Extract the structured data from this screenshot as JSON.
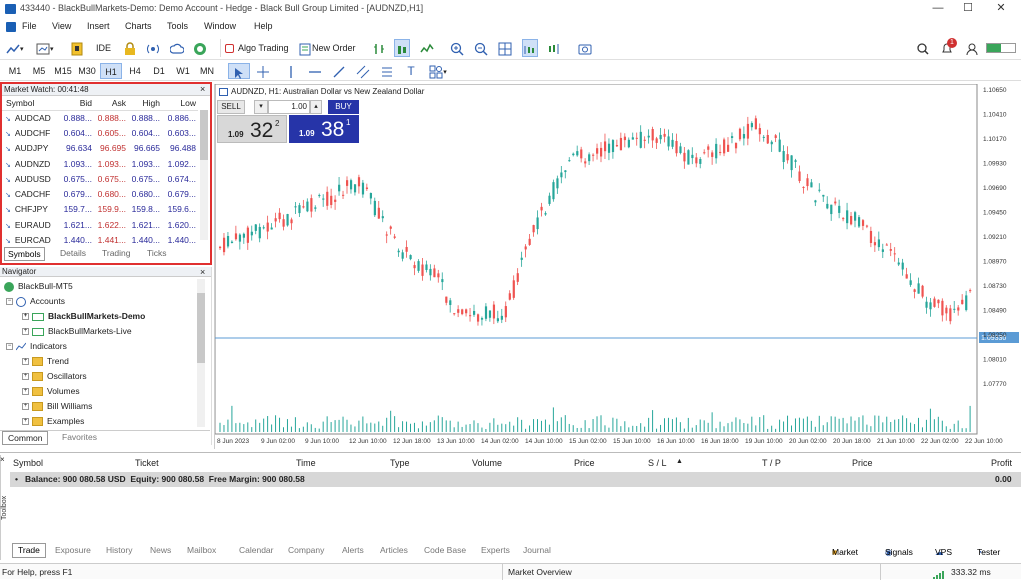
{
  "window": {
    "title": "433440 - BlackBullMarkets-Demo: Demo Account - Hedge - Black Bull Group Limited - [AUDNZD,H1]",
    "minimize": "—",
    "maximize": "☐",
    "close": "✕"
  },
  "menu": [
    "File",
    "View",
    "Insert",
    "Charts",
    "Tools",
    "Window",
    "Help"
  ],
  "toolbar": {
    "ide": "IDE",
    "algo_trading": "Algo Trading",
    "new_order": "New Order",
    "notifications_count": "1"
  },
  "timeframes": [
    "M1",
    "M5",
    "M15",
    "M30",
    "H1",
    "H4",
    "D1",
    "W1",
    "MN"
  ],
  "active_timeframe": "H1",
  "market_watch": {
    "title": "Market Watch: 00:41:48",
    "columns": [
      "Symbol",
      "Bid",
      "Ask",
      "High",
      "Low"
    ],
    "rows": [
      {
        "symbol": "AUDCAD",
        "bid": "0.888...",
        "ask": "0.888...",
        "high": "0.888...",
        "low": "0.886..."
      },
      {
        "symbol": "AUDCHF",
        "bid": "0.604...",
        "ask": "0.605...",
        "high": "0.604...",
        "low": "0.603..."
      },
      {
        "symbol": "AUDJPY",
        "bid": "96.634",
        "ask": "96.695",
        "high": "96.665",
        "low": "96.488"
      },
      {
        "symbol": "AUDNZD",
        "bid": "1.093...",
        "ask": "1.093...",
        "high": "1.093...",
        "low": "1.092..."
      },
      {
        "symbol": "AUDUSD",
        "bid": "0.675...",
        "ask": "0.675...",
        "high": "0.675...",
        "low": "0.674..."
      },
      {
        "symbol": "CADCHF",
        "bid": "0.679...",
        "ask": "0.680...",
        "high": "0.680...",
        "low": "0.679..."
      },
      {
        "symbol": "CHFJPY",
        "bid": "159.7...",
        "ask": "159.9...",
        "high": "159.8...",
        "low": "159.6..."
      },
      {
        "symbol": "EURAUD",
        "bid": "1.621...",
        "ask": "1.622...",
        "high": "1.621...",
        "low": "1.620..."
      },
      {
        "symbol": "EURCAD",
        "bid": "1.440...",
        "ask": "1.441...",
        "high": "1.440...",
        "low": "1.440..."
      }
    ],
    "tabs": [
      "Symbols",
      "Details",
      "Trading",
      "Ticks"
    ]
  },
  "navigator": {
    "title": "Navigator",
    "root": "BlackBull-MT5",
    "accounts": "Accounts",
    "account_demo": "BlackBullMarkets-Demo",
    "account_live": "BlackBullMarkets-Live",
    "indicators": "Indicators",
    "folders": [
      "Trend",
      "Oscillators",
      "Volumes",
      "Bill Williams",
      "Examples"
    ],
    "tabs": [
      "Common",
      "Favorites"
    ]
  },
  "chart": {
    "header": "AUDNZD, H1: Australian Dollar vs New Zealand Dollar",
    "sell_label": "SELL",
    "buy_label": "BUY",
    "volume": "1.00",
    "sell_price_prefix": "1.09",
    "sell_price_big": "32",
    "sell_price_sup": "2",
    "buy_price_prefix": "1.09",
    "buy_price_big": "38",
    "buy_price_sup": "1",
    "current_price": "1.09330",
    "price_levels": [
      "1.10650",
      "1.10410",
      "1.10170",
      "1.09930",
      "1.09690",
      "1.09450",
      "1.09210",
      "1.08970",
      "1.08730",
      "1.08490",
      "1.08250",
      "1.08010",
      "1.07770"
    ],
    "time_labels": [
      "8 Jun 2023",
      "9 Jun 02:00",
      "9 Jun 10:00",
      "12 Jun 10:00",
      "12 Jun 18:00",
      "13 Jun 10:00",
      "14 Jun 02:00",
      "14 Jun 10:00",
      "15 Jun 02:00",
      "15 Jun 10:00",
      "16 Jun 10:00",
      "16 Jun 18:00",
      "19 Jun 10:00",
      "20 Jun 02:00",
      "20 Jun 18:00",
      "21 Jun 10:00",
      "22 Jun 02:00",
      "22 Jun 10:00"
    ],
    "colors": {
      "bull": "#26a69a",
      "bear": "#ef5350",
      "hline": "#5b9bd5",
      "volume": "#26a69a"
    }
  },
  "toolbox": {
    "label": "Toolbox",
    "columns": [
      "Symbol",
      "Ticket",
      "Time",
      "Type",
      "Volume",
      "Price",
      "S / L",
      "T / P",
      "Price",
      "Profit"
    ],
    "balance_line": "Balance: 900 080.58 USD  Equity: 900 080.58  Free Margin: 900 080.58",
    "profit_total": "0.00",
    "tabs": [
      "Trade",
      "Exposure",
      "History",
      "News",
      "Mailbox",
      "Calendar",
      "Company",
      "Alerts",
      "Articles",
      "Code Base",
      "Experts",
      "Journal"
    ],
    "right_links": [
      "Market",
      "Signals",
      "VPS",
      "Tester"
    ]
  },
  "status": {
    "help": "For Help, press F1",
    "profile": "Market Overview",
    "ping": "333.32 ms"
  }
}
